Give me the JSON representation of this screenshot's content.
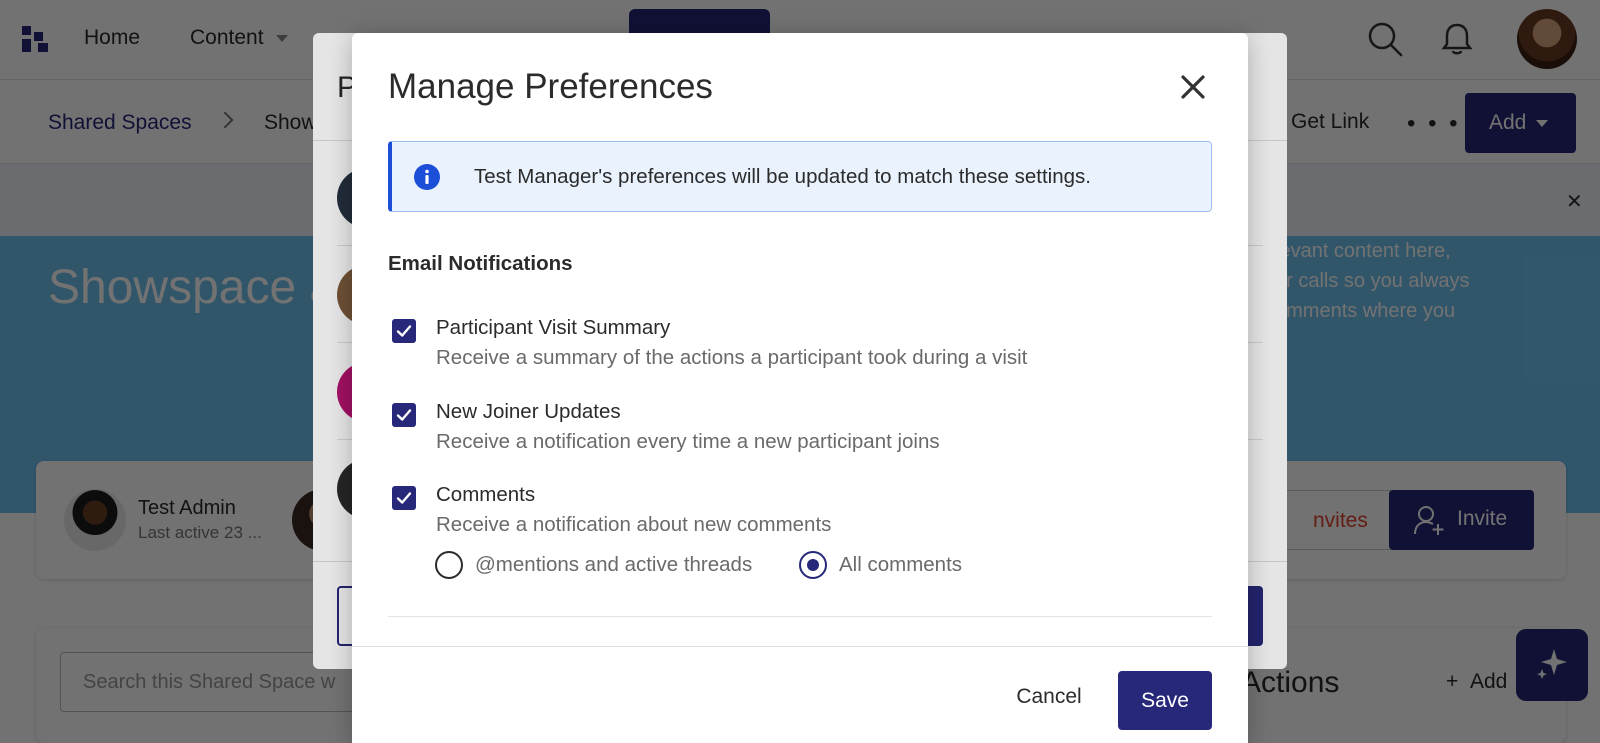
{
  "topnav": {
    "items": [
      {
        "label": "Home"
      },
      {
        "label": "Content"
      }
    ],
    "icons": [
      "logo-icon",
      "search-icon",
      "bell-icon",
      "avatar"
    ]
  },
  "subnav": {
    "breadcrumb": [
      "Shared Spaces",
      "Show"
    ],
    "get_link": "Get Link",
    "more": "• • •",
    "add_label": "Add"
  },
  "hero": {
    "title": "Showspace a",
    "text_lines": [
      "levant content here,",
      "ur calls so you always",
      "omments where you"
    ]
  },
  "people": {
    "name": "Test Admin",
    "last_active": "Last active 23 ...",
    "invites_label": "nvites",
    "invite_label": "Invite"
  },
  "search": {
    "placeholder": "Search this Shared Space w"
  },
  "actions": {
    "title": "Actions",
    "add_label": "Add"
  },
  "under_modal": {
    "title": "P"
  },
  "modal": {
    "title": "Manage Preferences",
    "info": "Test Manager's preferences will be updated to match these settings.",
    "section_title": "Email Notifications",
    "preferences": [
      {
        "title": "Participant Visit Summary",
        "description": "Receive a summary of the actions a participant took during a visit",
        "checked": true
      },
      {
        "title": "New Joiner Updates",
        "description": "Receive a notification every time a new participant joins",
        "checked": true
      },
      {
        "title": "Comments",
        "description": "Receive a notification about new comments",
        "checked": true
      }
    ],
    "comment_options": [
      {
        "label": "@mentions and active threads",
        "selected": false
      },
      {
        "label": "All comments",
        "selected": true
      }
    ],
    "cancel_label": "Cancel",
    "save_label": "Save"
  },
  "colors": {
    "primary": "#27287a",
    "info_accent": "#1c4fd8",
    "info_bg": "#eaf2fd",
    "hero": "#6fc0ef"
  }
}
